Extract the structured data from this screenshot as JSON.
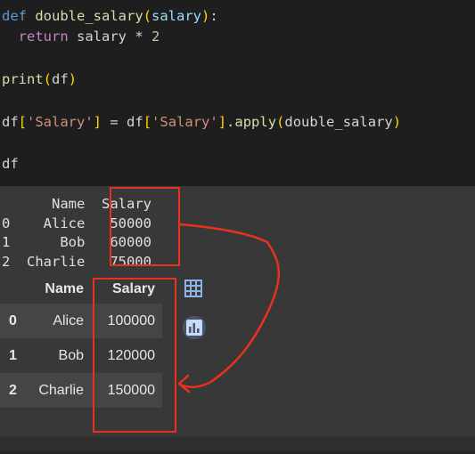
{
  "code": {
    "line1": {
      "kw": "def",
      "fn": "double_salary",
      "open": "(",
      "param": "salary",
      "close": ")",
      "colon": ":"
    },
    "line2": {
      "kw": "return",
      "rest": " salary * ",
      "num": "2"
    },
    "line3": {
      "fn": "print",
      "open": "(",
      "arg": "df",
      "close": ")"
    },
    "line4": {
      "df1": "df",
      "br1": "[",
      "str1": "'Salary'",
      "br1c": "]",
      "eq": " = ",
      "df2": "df",
      "br2": "[",
      "str2": "'Salary'",
      "br2c": "]",
      "dot": ".",
      "apply": "apply",
      "open": "(",
      "arg": "double_salary",
      "close": ")"
    },
    "line5": "df"
  },
  "printed_output": {
    "header": "      Name  Salary",
    "rows": [
      "0    Alice   50000",
      "1      Bob   60000",
      "2  Charlie   75000"
    ]
  },
  "dataframe": {
    "columns": [
      "",
      "Name",
      "Salary"
    ],
    "rows": [
      {
        "index": "0",
        "name": "Alice",
        "salary": "100000"
      },
      {
        "index": "1",
        "name": "Bob",
        "salary": "120000"
      },
      {
        "index": "2",
        "name": "Charlie",
        "salary": "150000"
      }
    ]
  },
  "icons": {
    "table": "table-icon",
    "chart": "bar-chart-icon"
  },
  "colors": {
    "annotation": "#e8321f",
    "editor_bg": "#1e1e1e",
    "output_bg": "#383838"
  }
}
